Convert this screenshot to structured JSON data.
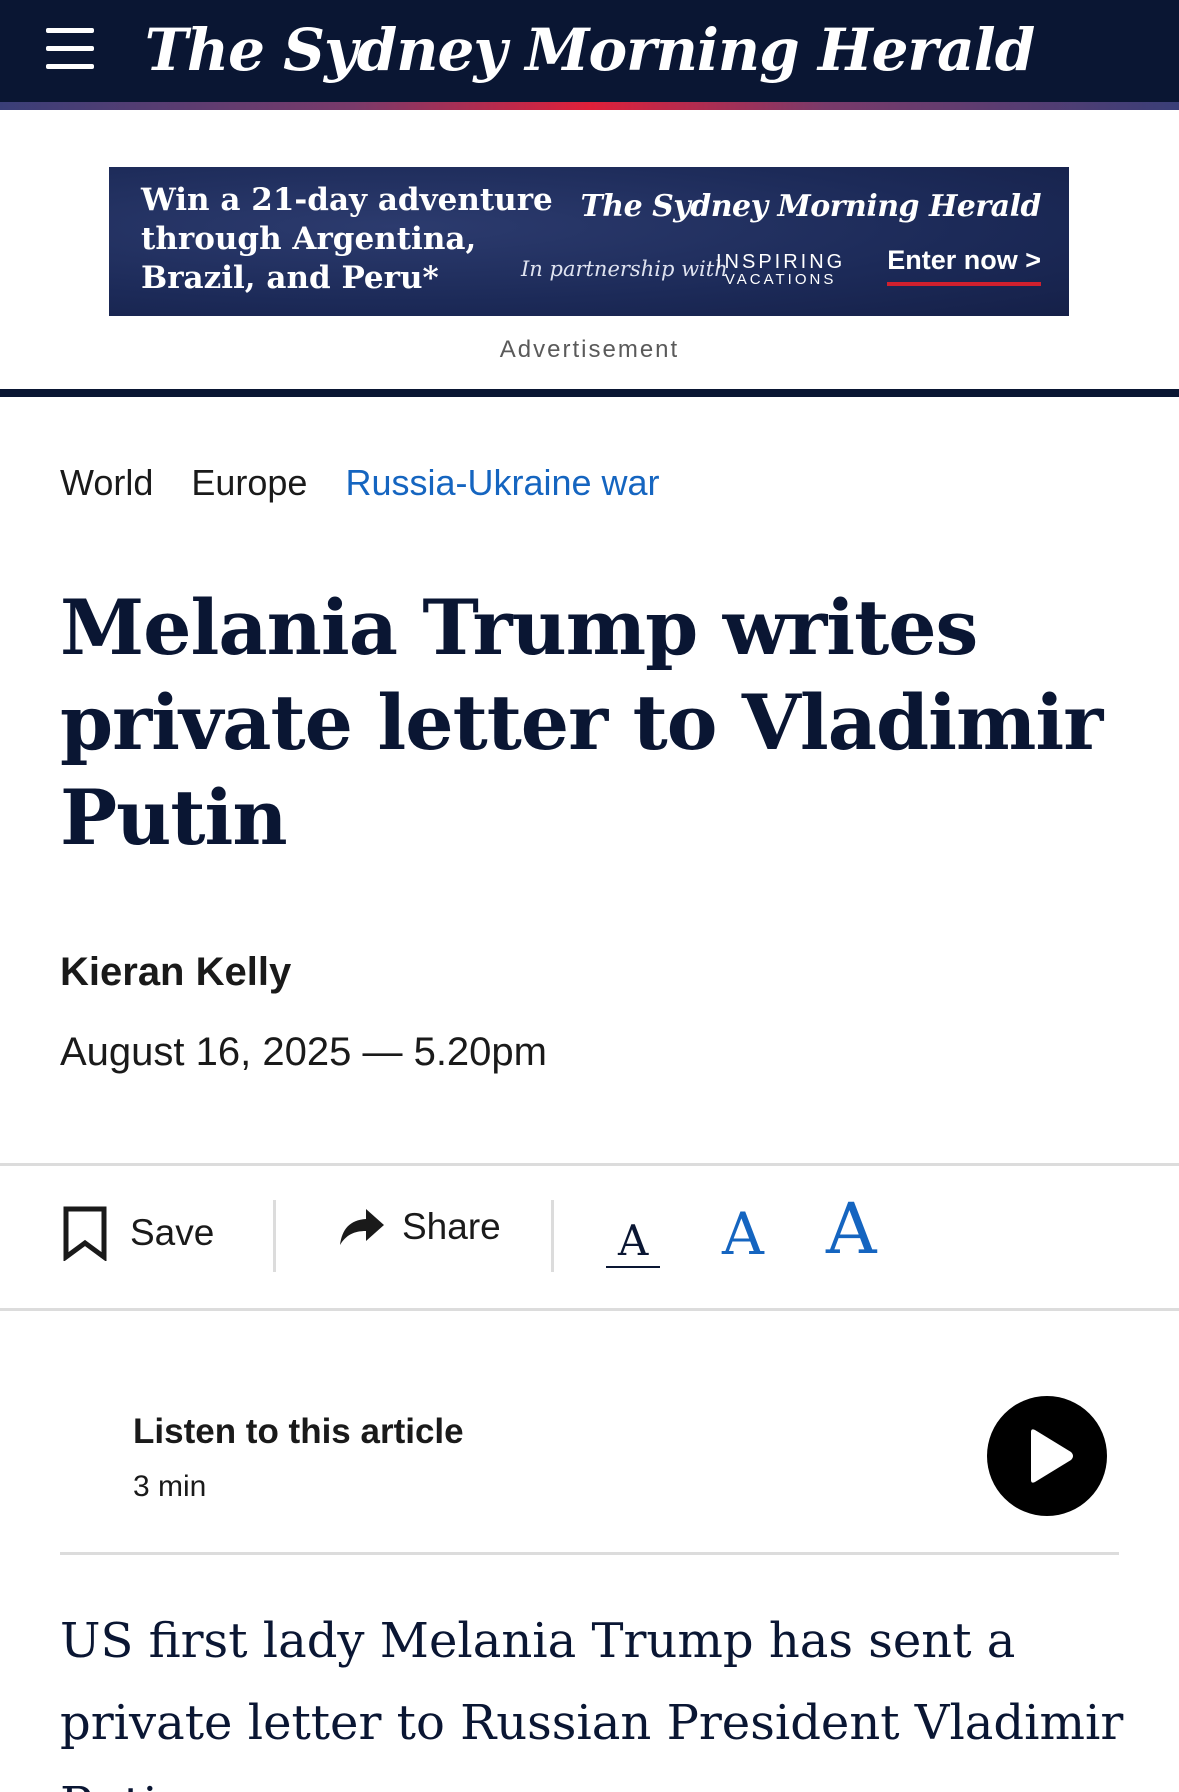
{
  "header": {
    "masthead": "The Sydney Morning Herald",
    "menu_icon": "hamburger-menu-icon"
  },
  "ad": {
    "headline": "Win a 21-day adventure through Argentina, Brazil, and Peru*",
    "logo": "The Sydney Morning Herald",
    "partner_text": "In partnership with",
    "partner_brand": "INSPIRING",
    "partner_brand_sub": "VACATIONS",
    "cta": "Enter now >",
    "label": "Advertisement"
  },
  "breadcrumb": {
    "items": [
      "World",
      "Europe",
      "Russia-Ukraine war"
    ]
  },
  "article": {
    "headline": "Melania Trump writes private letter to Vladimir Putin",
    "author": "Kieran Kelly",
    "date": "August 16, 2025 — 5.20pm",
    "lead": "US first lady Melania Trump has sent a private letter to Russian President Vladimir Putin"
  },
  "toolbar": {
    "save_label": "Save",
    "share_label": "Share",
    "font_small": "A",
    "font_medium": "A",
    "font_large": "A"
  },
  "listen": {
    "title": "Listen to this article",
    "duration": "3 min"
  },
  "colors": {
    "navy": "#0a1633",
    "link_blue": "#1565c0",
    "accent_red": "#d0202e"
  }
}
